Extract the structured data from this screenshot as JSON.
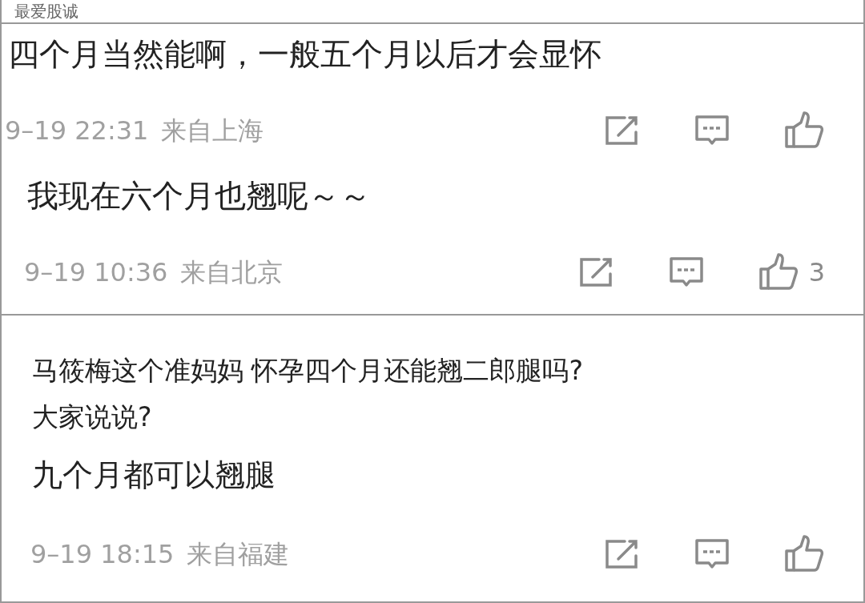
{
  "panels": [
    {
      "header": "最爱股诚",
      "comments": [
        {
          "kind": "comment",
          "text": "四个月当然能啊，一般五个月以后才会显怀",
          "time": "9–19 22:31",
          "location": "来自上海"
        },
        {
          "kind": "reply",
          "text": "我现在六个月也翘呢～～",
          "time": "9–19 10:36",
          "location": "来自北京",
          "likes": "3"
        }
      ]
    },
    {
      "question_lines": [
        "马筱梅这个准妈妈 怀孕四个月还能翘二郎腿吗?",
        "大家说说?"
      ],
      "comments": [
        {
          "kind": "answer",
          "text": "九个月都可以翘腿",
          "time": "9–19 18:15",
          "location": "来自福建"
        }
      ]
    }
  ]
}
